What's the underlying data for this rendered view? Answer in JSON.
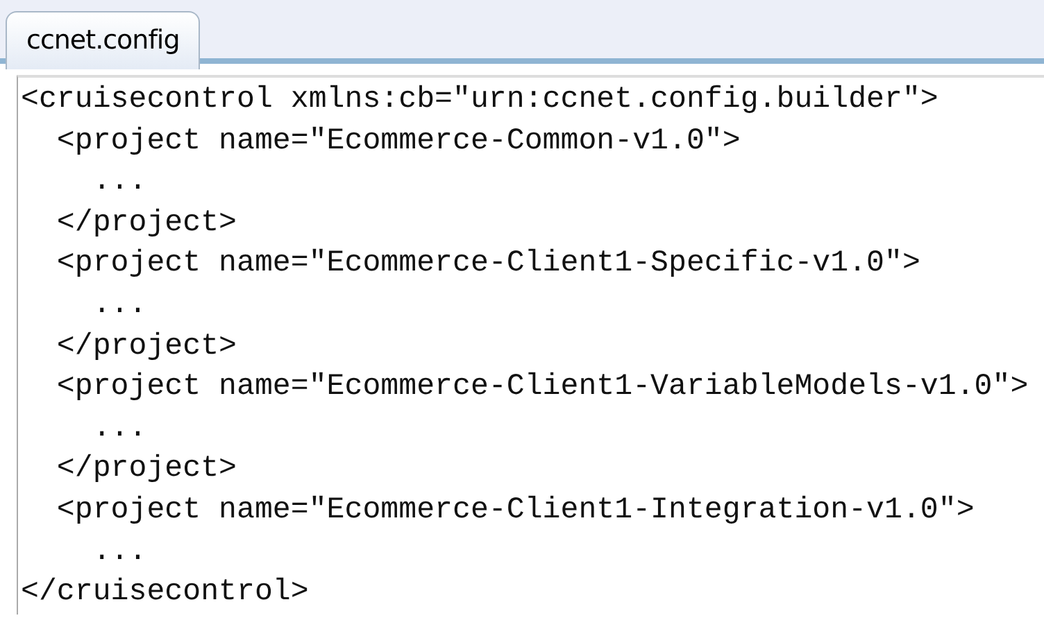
{
  "tabs": [
    {
      "label": "ccnet.config",
      "selected": true
    }
  ],
  "editor": {
    "lines": [
      "<cruisecontrol xmlns:cb=\"urn:ccnet.config.builder\">",
      "  <project name=\"Ecommerce-Common-v1.0\">",
      "    ...",
      "  </project>",
      "  <project name=\"Ecommerce-Client1-Specific-v1.0\">",
      "    ...",
      "  </project>",
      "  <project name=\"Ecommerce-Client1-VariableModels-v1.0\">",
      "    ...",
      "  </project>",
      "  <project name=\"Ecommerce-Client1-Integration-v1.0\">",
      "    ...",
      "</cruisecontrol>"
    ]
  }
}
